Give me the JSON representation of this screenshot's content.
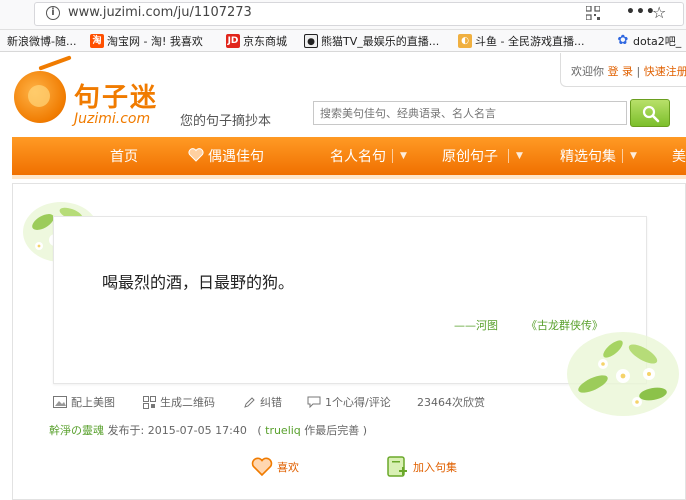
{
  "browser": {
    "url": "www.juzimi.com/ju/1107273",
    "bookmarks": [
      {
        "label": "新浪微博-随...",
        "icon": "weibo-icon",
        "color": "#e6162d"
      },
      {
        "label": "淘宝网 - 淘! 我喜欢",
        "icon": "taobao-icon",
        "color": "#ff5000"
      },
      {
        "label": "京东商城",
        "icon": "jd-icon",
        "color": "#e1251b"
      },
      {
        "label": "熊猫TV_最娱乐的直播...",
        "icon": "panda-icon",
        "color": "#222222"
      },
      {
        "label": "斗鱼 - 全民游戏直播...",
        "icon": "douyu-icon",
        "color": "#f07b00"
      },
      {
        "label": "dota2吧_",
        "icon": "baidu-tieba-icon",
        "color": "#2f67e0"
      }
    ]
  },
  "header": {
    "logo_cn": "句子迷",
    "logo_en": "Juzimi.com",
    "slogan": "您的句子摘抄本",
    "welcome": "欢迎你",
    "login": "登 录",
    "quick_register": "快速注册",
    "search_placeholder": "搜索美句佳句、经典语录、名人名言"
  },
  "nav": {
    "items": [
      {
        "label": "首页"
      },
      {
        "label": "偶遇佳句"
      },
      {
        "label": "名人名句"
      },
      {
        "label": "原创句子"
      },
      {
        "label": "精选句集"
      },
      {
        "label": "美"
      }
    ]
  },
  "quote": {
    "text": "喝最烈的酒，日最野的狗。",
    "author": "——河图",
    "book": "《古龙群侠传》"
  },
  "actions": {
    "image": "配上美图",
    "qrcode": "生成二维码",
    "correct": "纠错",
    "comments": "1个心得/评论",
    "views": "23464次欣赏"
  },
  "meta": {
    "uploader": "幹淨の靈魂",
    "published": "发布于: 2015-07-05 17:40",
    "editor_prefix": "(",
    "editor": "trueliq",
    "editor_suffix": "作最后完善 )"
  },
  "buttons": {
    "like": "喜欢",
    "add_to_collection": "加入句集"
  },
  "colors": {
    "brand_orange": "#f07b00",
    "green_text": "#58a02c"
  }
}
